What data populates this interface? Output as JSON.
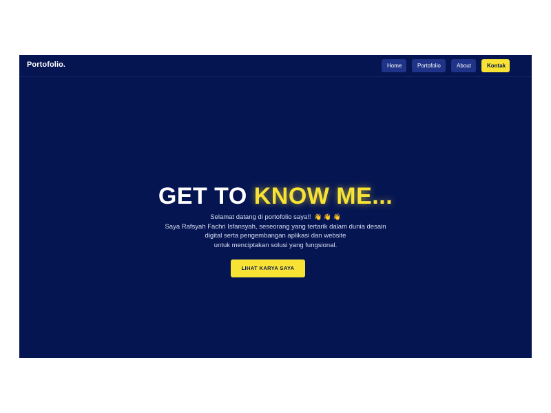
{
  "nav": {
    "brand": "Portofolio.",
    "links": [
      {
        "label": "Home"
      },
      {
        "label": "Portofolio"
      },
      {
        "label": "About"
      },
      {
        "label": "Kontak"
      }
    ]
  },
  "hero": {
    "title_white": "GET TO ",
    "title_yellow": "KNOW ME...",
    "greeting": "Selamat datang di portofolio saya!!",
    "emojis": "👋 👋 👋",
    "description_lines": [
      "Saya Rafsyah Fachri Isfansyah, seseorang yang tertarik dalam dunia desain",
      "digital serta pengembangan aplikasi dan website",
      "untuk menciptakan solusi yang fungsional."
    ],
    "cta_label": "LIHAT KARYA SAYA"
  },
  "colors": {
    "background": "#051552",
    "accent": "#f8e335",
    "nav_button": "#1f3488"
  }
}
